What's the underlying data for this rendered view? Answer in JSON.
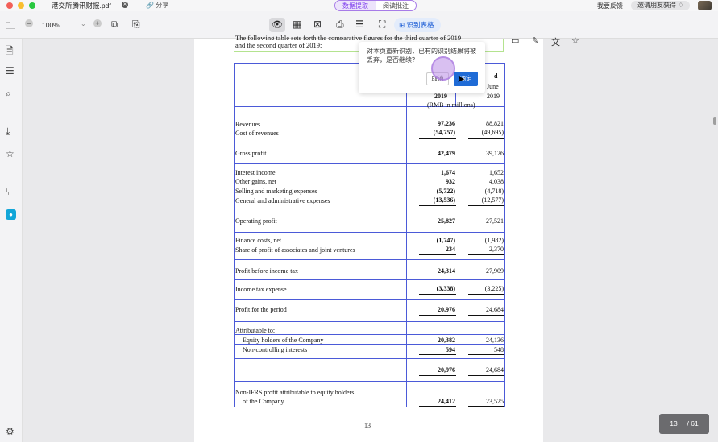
{
  "titlebar": {
    "tab_title": "港交所腾讯财报.pdf",
    "share_label": "分享",
    "mode_tabs": [
      "数据提取",
      "阅读批注"
    ],
    "feedback_label": "我要反馈",
    "invite_label": "邀请朋友获得"
  },
  "toolbar": {
    "zoom": "100%",
    "identify_table": "识别表格"
  },
  "doc": {
    "intro_top": "The following table sets forth the comparative figures for the third quarter of 2019",
    "intro_line": "and the second quarter of 2019:",
    "header": {
      "col2_top": "d",
      "col2_mid": "June",
      "col1_year": "2019",
      "col2_year": "2019",
      "units": "(RMB in millions)"
    },
    "rows": [
      {
        "label": "Revenues",
        "q3": "97,236",
        "q2": "88,821"
      },
      {
        "label": "Cost of revenues",
        "q3": "(54,757)",
        "q2": "(49,695)"
      },
      {
        "label": "Gross profit",
        "q3": "42,479",
        "q2": "39,126"
      },
      {
        "label": "Interest income",
        "q3": "1,674",
        "q2": "1,652"
      },
      {
        "label": "Other gains, net",
        "q3": "932",
        "q2": "4,038"
      },
      {
        "label": "Selling and marketing expenses",
        "q3": "(5,722)",
        "q2": "(4,718)"
      },
      {
        "label": "General and administrative expenses",
        "q3": "(13,536)",
        "q2": "(12,577)"
      },
      {
        "label": "Operating profit",
        "q3": "25,827",
        "q2": "27,521"
      },
      {
        "label": "Finance costs, net",
        "q3": "(1,747)",
        "q2": "(1,982)"
      },
      {
        "label": "Share of profit of associates and joint ventures",
        "q3": "234",
        "q2": "2,370"
      },
      {
        "label": "Profit before income tax",
        "q3": "24,314",
        "q2": "27,909"
      },
      {
        "label": "Income tax expense",
        "q3": "(3,338)",
        "q2": "(3,225)"
      },
      {
        "label": "Profit for the period",
        "q3": "20,976",
        "q2": "24,684"
      },
      {
        "label": "Attributable to:",
        "q3": "",
        "q2": ""
      },
      {
        "label": "Equity holders of the Company",
        "q3": "20,382",
        "q2": "24,136"
      },
      {
        "label": "Non-controlling interests",
        "q3": "594",
        "q2": "548"
      },
      {
        "label": "",
        "q3": "20,976",
        "q2": "24,684"
      },
      {
        "label": "Non-IFRS profit attributable to equity holders",
        "q3": "",
        "q2": ""
      },
      {
        "label": "of the Company",
        "q3": "24,412",
        "q2": "23,525"
      }
    ],
    "page_number": "13"
  },
  "popup": {
    "message": "对本页重新识别，已有的识别结果将被丢弃，是否继续？",
    "cancel": "取消",
    "ok": "确定"
  },
  "page_indicator": {
    "current": "13",
    "total": "/ 61"
  },
  "colors": {
    "accent": "#1f6bd6",
    "mode_active": "#7c3aed",
    "table_border": "#4b5ad8"
  }
}
